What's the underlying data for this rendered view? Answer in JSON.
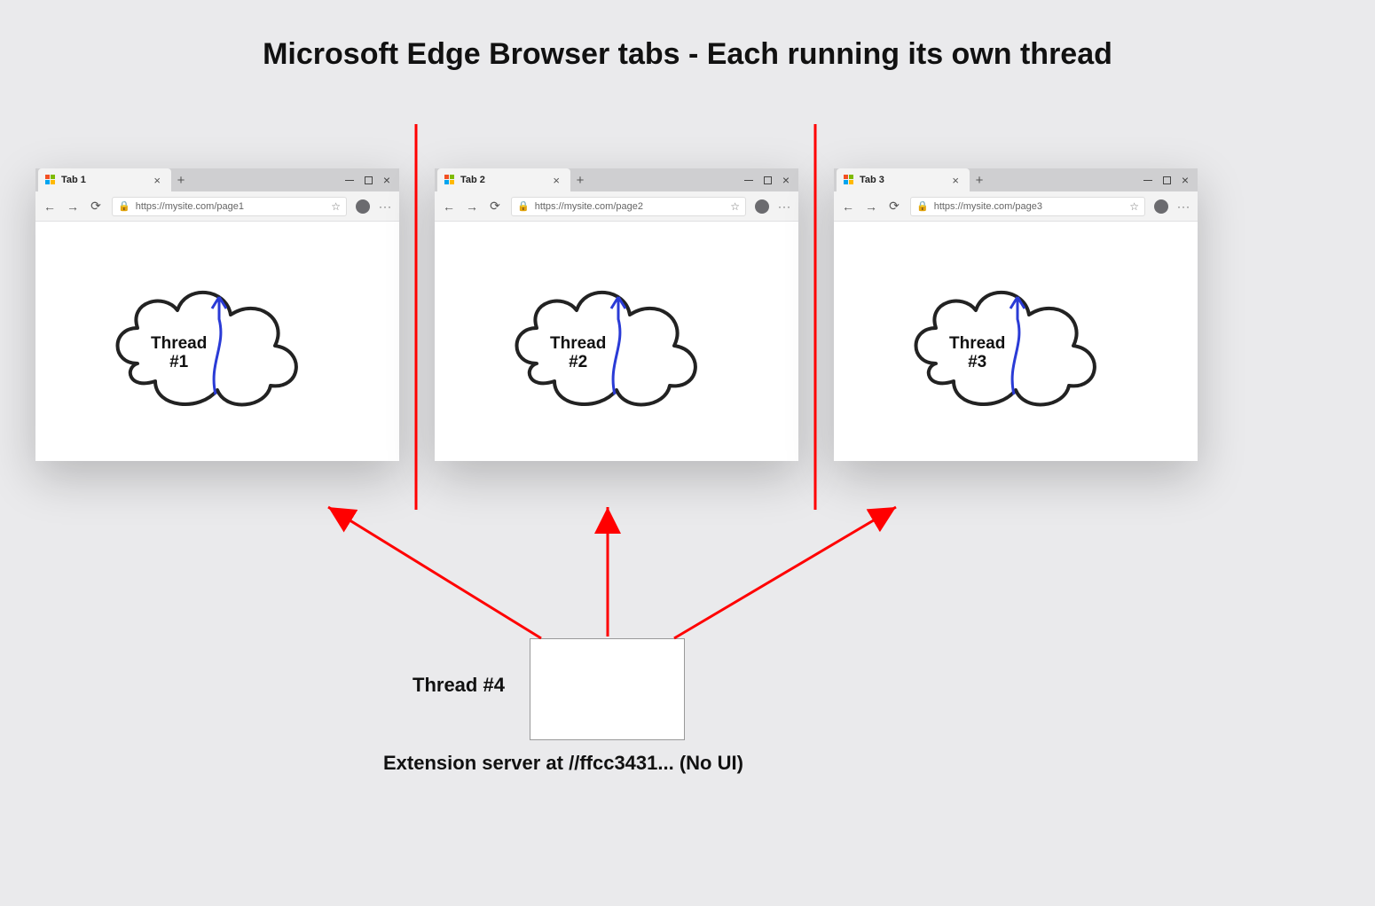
{
  "title": "Microsoft Edge Browser tabs - Each running its own thread",
  "windows": [
    {
      "tab_label": "Tab 1",
      "url": "https://mysite.com/page1",
      "thread_line1": "Thread",
      "thread_line2": "#1"
    },
    {
      "tab_label": "Tab 2",
      "url": "https://mysite.com/page2",
      "thread_line1": "Thread",
      "thread_line2": "#2"
    },
    {
      "tab_label": "Tab 3",
      "url": "https://mysite.com/page3",
      "thread_line1": "Thread",
      "thread_line2": "#3"
    }
  ],
  "extension": {
    "thread_label": "Thread #4",
    "caption": "Extension server at //ffcc3431... (No UI)"
  },
  "glyphs": {
    "close_x": "×",
    "plus": "+",
    "back": "←",
    "fwd": "→",
    "reload": "⟳",
    "lock": "🔒",
    "star": "☆",
    "dots": "···"
  },
  "colors": {
    "accent_red": "#ff0000",
    "thread_blue": "#2a3bd6"
  }
}
